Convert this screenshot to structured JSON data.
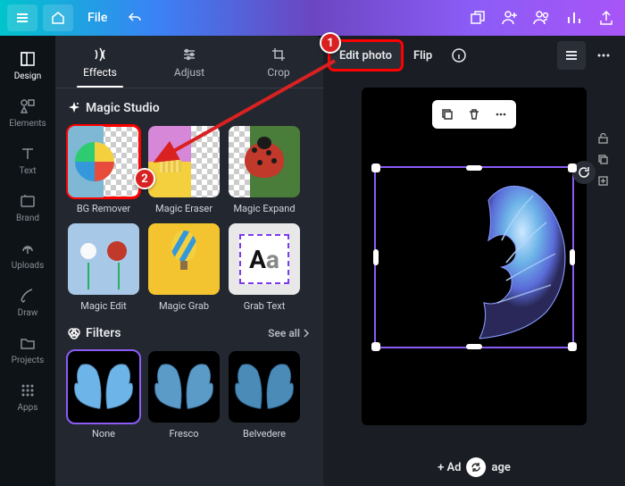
{
  "topbar": {
    "file_label": "File"
  },
  "sidebar": {
    "items": [
      {
        "label": "Design"
      },
      {
        "label": "Elements"
      },
      {
        "label": "Text"
      },
      {
        "label": "Brand"
      },
      {
        "label": "Uploads"
      },
      {
        "label": "Draw"
      },
      {
        "label": "Projects"
      },
      {
        "label": "Apps"
      }
    ]
  },
  "panel": {
    "tabs": {
      "effects": "Effects",
      "adjust": "Adjust",
      "crop": "Crop"
    },
    "magic_studio_title": "Magic Studio",
    "filters_title": "Filters",
    "see_all": "See all",
    "tiles": [
      {
        "label": "BG Remover"
      },
      {
        "label": "Magic Eraser"
      },
      {
        "label": "Magic Expand"
      },
      {
        "label": "Magic Edit"
      },
      {
        "label": "Magic Grab"
      },
      {
        "label": "Grab Text"
      }
    ],
    "filters": [
      {
        "label": "None"
      },
      {
        "label": "Fresco"
      },
      {
        "label": "Belvedere"
      }
    ]
  },
  "context_bar": {
    "edit_photo": "Edit photo",
    "flip": "Flip"
  },
  "canvas": {
    "add_page": "+ Add page"
  },
  "annotations": {
    "marker1": "1",
    "marker2": "2"
  }
}
